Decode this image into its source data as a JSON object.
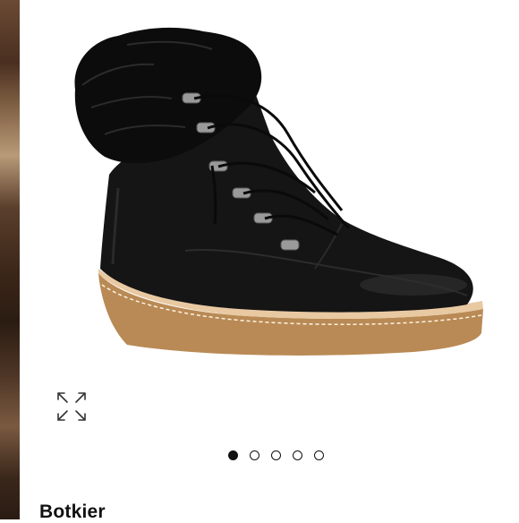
{
  "product": {
    "brand": "Botkier",
    "image_description_icon": "boot-photo"
  },
  "gallery": {
    "total_images": 5,
    "active_index": 0,
    "expand_icon": "expand-arrows-icon"
  }
}
